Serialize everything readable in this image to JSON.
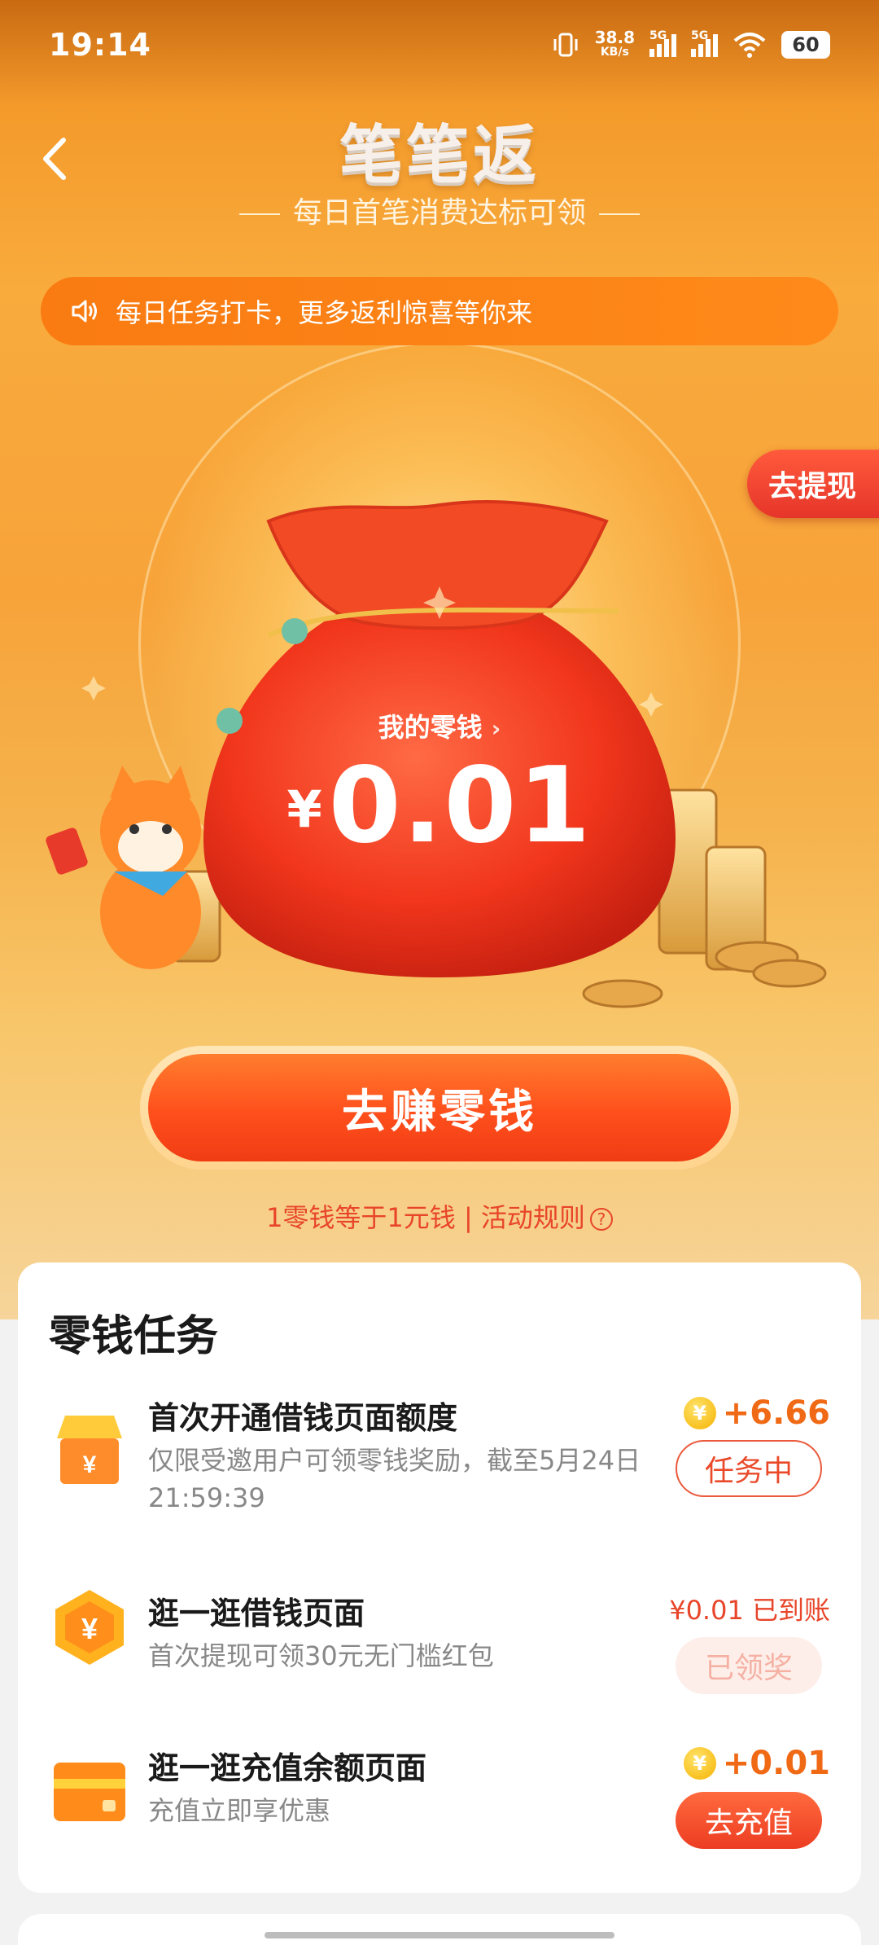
{
  "status_bar": {
    "time": "19:14",
    "net_speed_value": "38.8",
    "net_speed_unit": "KB/s",
    "signal_1_label": "5G",
    "signal_2_label": "5G",
    "battery": "60"
  },
  "header": {
    "title": "笔笔返",
    "subtitle": "每日首笔消费达标可领"
  },
  "notice": {
    "text": "每日任务打卡，更多返利惊喜等你来"
  },
  "withdraw_tab": "去提现",
  "wallet": {
    "label": "我的零钱",
    "currency": "¥",
    "amount": "0.01"
  },
  "earn_button": "去赚零钱",
  "rule_line": {
    "exchange": "1零钱等于1元钱",
    "separator": " | ",
    "rules": "活动规则"
  },
  "tasks": {
    "heading": "零钱任务",
    "items": [
      {
        "name": "首次开通借钱页面额度",
        "desc": "仅限受邀用户可领零钱奖励，截至5月24日21:59:39",
        "reward": "+6.66",
        "action": "任务中"
      },
      {
        "name": "逛一逛借钱页面",
        "desc": "首次提现可领30元无门槛红包",
        "reward": "¥0.01 已到账",
        "action": "已领奖"
      },
      {
        "name": "逛一逛充值余额页面",
        "desc": "充值立即享优惠",
        "reward": "+0.01",
        "action": "去充值"
      }
    ]
  },
  "colors": {
    "brand_orange": "#f97b12",
    "accent_red": "#e8452a",
    "reward_orange": "#f06a16"
  }
}
